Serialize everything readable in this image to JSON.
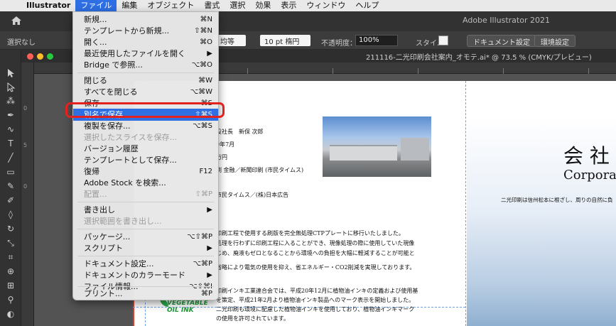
{
  "menubar": {
    "app_name": "Illustrator",
    "items": [
      "ファイル",
      "編集",
      "オブジェクト",
      "書式",
      "選択",
      "効果",
      "表示",
      "ウィンドウ",
      "ヘルプ"
    ]
  },
  "app_title": "Adobe Illustrator 2021",
  "options_bar": {
    "no_selection": "選択なし",
    "stroke_profile": "均等",
    "brush": "10 pt 楕円",
    "opacity_label": "不透明度：",
    "opacity_value": "100%",
    "style_label": "スタイル：",
    "document_setup_button": "ドキュメント設定",
    "preferences_button": "環境設定"
  },
  "document": {
    "tab_title": "211116-二光印刷会社案内_オモテ.ai* @ 73.5 % (CMYK/プレビュー)",
    "ruler_numbers": [
      "0",
      "5",
      "0"
    ]
  },
  "artboard": {
    "lines": [
      "役社長　新保 次郎",
      "9年7月",
      "万円",
      "刷 金融／新聞印刷 (市民タイムス)",
      "市民タイムス／(株)日本広告",
      "印刷工程で使用する刷版を完全無処理CTPプレートに移行いたしました。",
      "処理を行わずに印刷工程に入ることができ、現像処理の際に使用していた現像",
      "じめ、廃液もゼロとなることから環境への負担を大幅に軽減することが可能と",
      "省略により電気の使用を抑え、省エネルギー・CO2削減を実現しております。",
      "印刷インキ工業連合会では、平成20年12月に植物油インキの定義および使用基",
      "を策定、平成21年2月より植物油インキ製品へのマーク表示を開始しました。",
      "二光印刷も環境に配慮した植物油インキを使用しており、植物油インキマーク",
      "の使用を許可されています。"
    ],
    "heading": "会 社",
    "heading_en": "Corporat",
    "tagline": "二光印刷は信州松本に根ざし、周りの自然に負",
    "logo_text": "VEGETABLE OIL INK"
  },
  "file_menu": {
    "items": [
      {
        "label": "新規...",
        "shortcut": "⌘N"
      },
      {
        "label": "テンプレートから新規...",
        "shortcut": "⇧⌘N"
      },
      {
        "label": "開く...",
        "shortcut": "⌘O"
      },
      {
        "label": "最近使用したファイルを開く",
        "shortcut": "▶"
      },
      {
        "label": "Bridge で参照...",
        "shortcut": "⌥⌘O"
      },
      {
        "label": "閉じる",
        "shortcut": "⌘W"
      },
      {
        "label": "すべてを閉じる",
        "shortcut": "⌥⌘W"
      },
      {
        "label": "保存",
        "shortcut": "⌘S"
      },
      {
        "label": "別名で保存...",
        "shortcut": "⇧⌘S"
      },
      {
        "label": "複製を保存...",
        "shortcut": "⌥⌘S"
      },
      {
        "label": "選択したスライスを保存...",
        "shortcut": ""
      },
      {
        "label": "バージョン履歴",
        "shortcut": ""
      },
      {
        "label": "テンプレートとして保存...",
        "shortcut": ""
      },
      {
        "label": "復帰",
        "shortcut": "F12"
      },
      {
        "label": "Adobe Stock を検索...",
        "shortcut": ""
      },
      {
        "label": "配置...",
        "shortcut": "⇧⌘P"
      },
      {
        "label": "書き出し",
        "shortcut": "▶"
      },
      {
        "label": "選択範囲を書き出し...",
        "shortcut": ""
      },
      {
        "label": "パッケージ...",
        "shortcut": "⌥⇧⌘P"
      },
      {
        "label": "スクリプト",
        "shortcut": "▶"
      },
      {
        "label": "ドキュメント設定...",
        "shortcut": "⌥⌘P"
      },
      {
        "label": "ドキュメントのカラーモード",
        "shortcut": "▶"
      },
      {
        "label": "ファイル情報...",
        "shortcut": "⌥⇧⌘I"
      },
      {
        "label": "プリント...",
        "shortcut": "⌘P"
      }
    ]
  },
  "colors": {
    "accent": "#2f6fe4",
    "callout": "#e3211f",
    "vegetable_green": "#1f9a3a"
  }
}
